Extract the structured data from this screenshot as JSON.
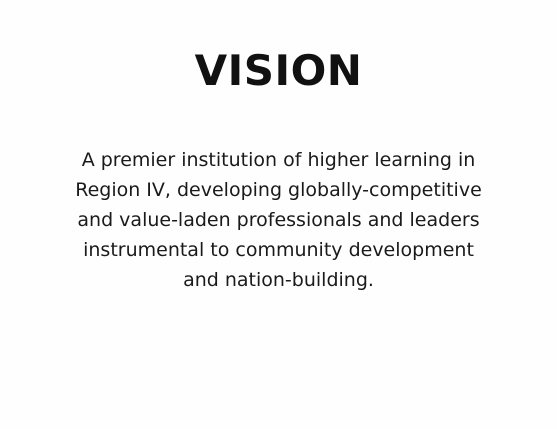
{
  "heading": "VISION",
  "statement_lines": [
    "A premier institution of higher learning in",
    "Region IV, developing globally-competitive",
    "and value-laden professionals and leaders",
    "instrumental to community development",
    "and nation-building."
  ],
  "colors": {
    "background": "#ffffff",
    "text": "#111111"
  }
}
